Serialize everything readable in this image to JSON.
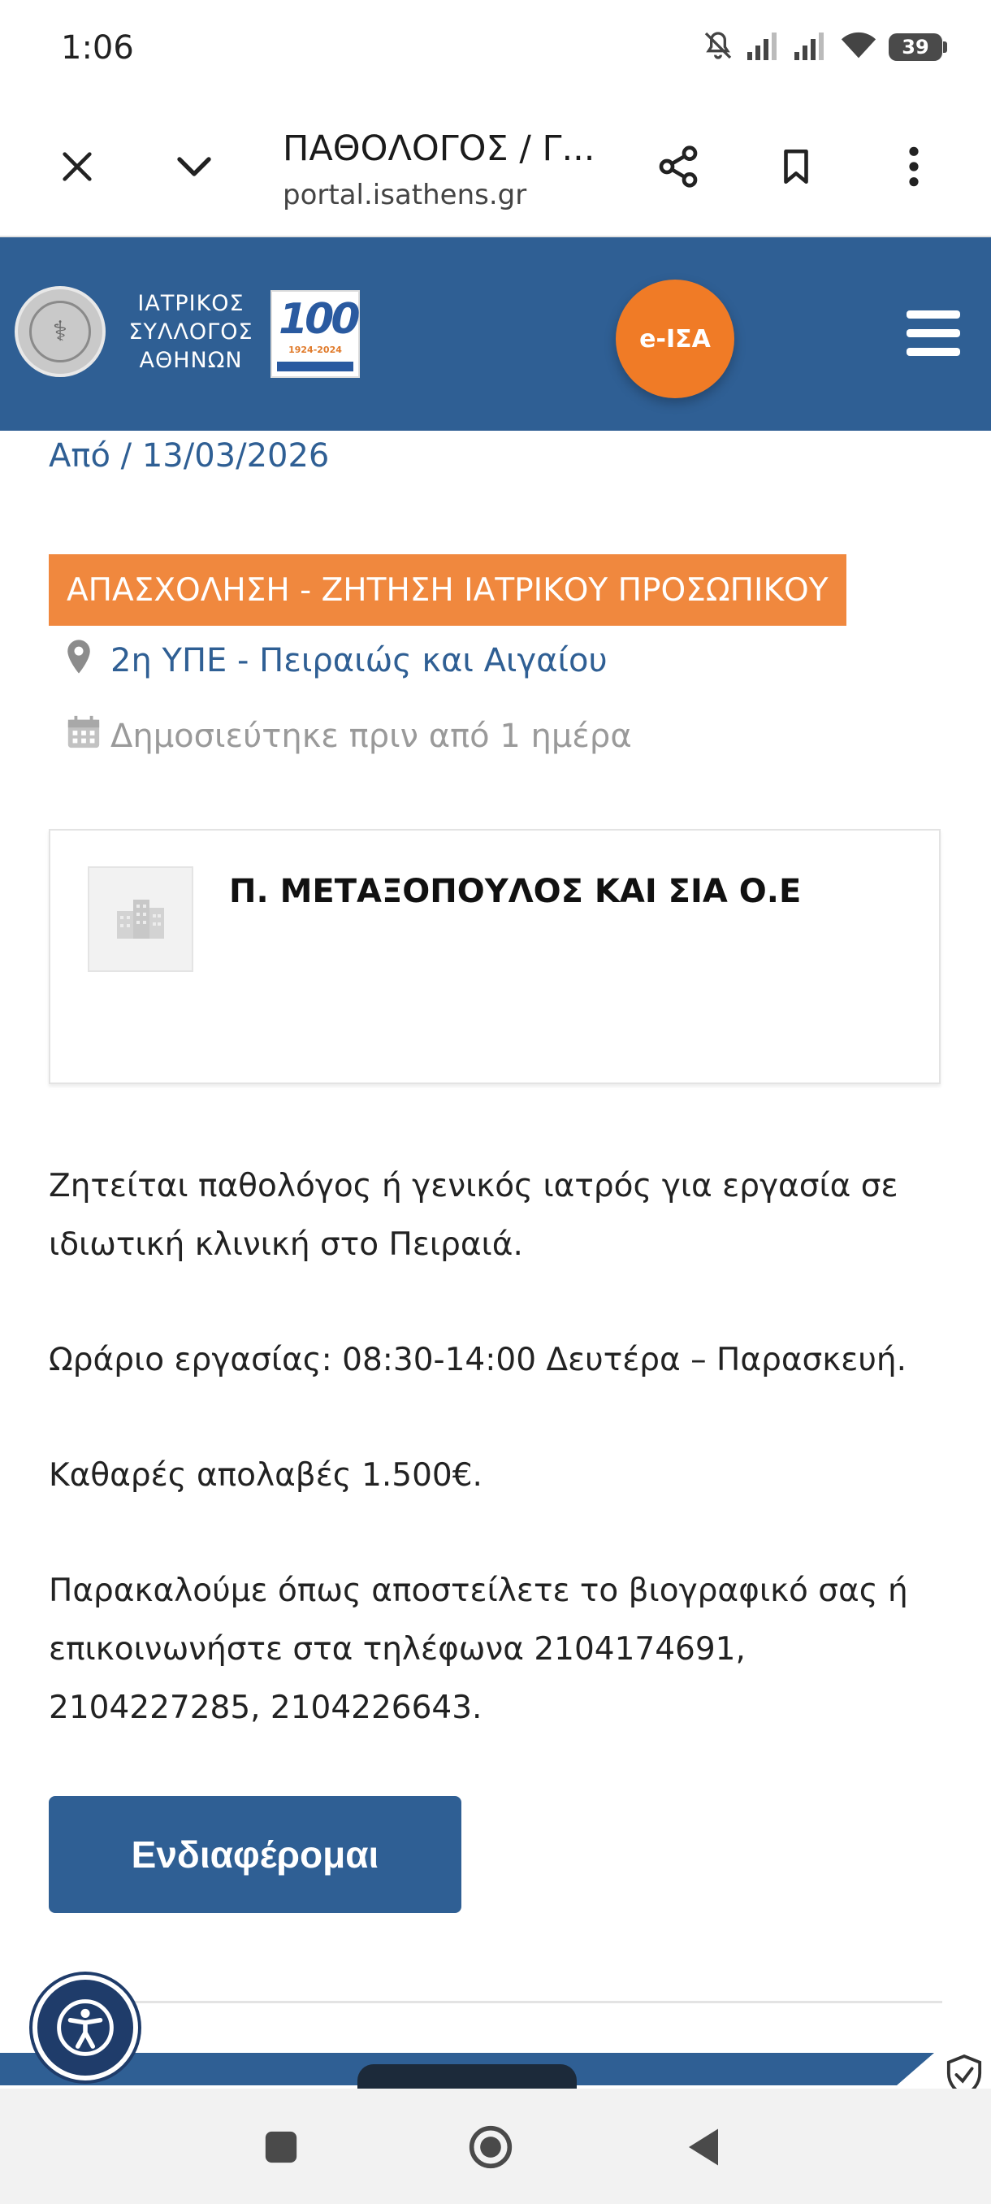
{
  "status_bar": {
    "time": "1:06",
    "battery": "39"
  },
  "custom_tab": {
    "title": "ΠΑΘΟΛΟΓΟΣ / Γ...",
    "url": "portal.isathens.gr"
  },
  "site_header": {
    "org_name": [
      "ΙΑΤΡΙΚΟΣ",
      "ΣΥΛΛΟΓΟΣ",
      "ΑΘΗΝΩΝ"
    ],
    "anniversary_number": "100",
    "anniversary_years": "1924-2024",
    "eisa_label": "e-ΙΣΑ"
  },
  "job": {
    "date": "Από / 13/03/2026",
    "category": "ΑΠΑΣΧΟΛΗΣΗ - ΖΗΤΗΣΗ ΙΑΤΡΙΚΟΥ ΠΡΟΣΩΠΙΚΟΥ",
    "location": "2η ΥΠΕ - Πειραιώς και Αιγαίου",
    "posted": "Δημοσιεύτηκε πριν από 1 ημέρα",
    "company": "Π. ΜΕΤΑΞΟΠΟΥΛΟΣ ΚΑΙ ΣΙΑ Ο.Ε",
    "description": [
      "Ζητείται παθολόγος ή γενικός ιατρός για εργασία σε ιδιωτική κλινική στο Πειραιά.",
      "Ωράριο εργασίας: 08:30-14:00 Δευτέρα – Παρασκευή.",
      "Καθαρές απολαβές 1.500€.",
      "Παρακαλούμε όπως αποστείλετε το βιογραφικό σας ή επικοινωνήστε στα τηλέφωνα 2104174691, 2104227285, 2104226643."
    ],
    "interest_button": "Ενδιαφέρομαι"
  },
  "icons": {
    "status": [
      "mute-icon",
      "signal-icon",
      "wifi-icon",
      "battery-icon"
    ],
    "tab": [
      "close-icon",
      "chevron-down-icon",
      "share-icon",
      "bookmark-icon",
      "more-vert-icon"
    ],
    "nav": [
      "recents-icon",
      "home-icon",
      "back-icon"
    ]
  },
  "colors": {
    "brand_blue": "#2f5f94",
    "accent_orange": "#f0883e",
    "eisa_orange": "#f07b26"
  }
}
